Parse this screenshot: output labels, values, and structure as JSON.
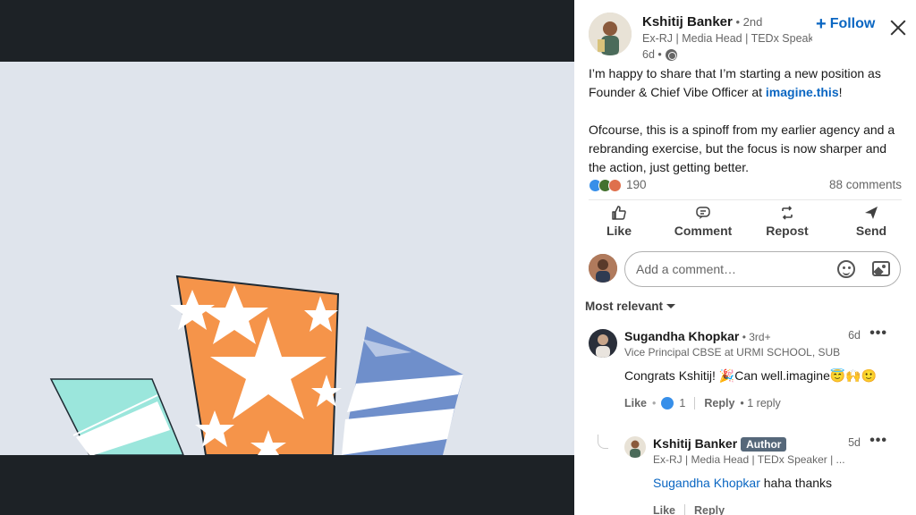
{
  "post": {
    "author_name": "Kshitij Banker",
    "author_degree": " • 2nd",
    "author_headline": "Ex-RJ | Media Head | TEDx Speak...",
    "time": "6d •",
    "follow_plus": "+",
    "follow_label": "Follow",
    "text_line1_prefix": "I’m happy to share that I’m starting a new position as Founder & Chief Vibe Officer at ",
    "text_link": "imagine.this",
    "text_line1_suffix": "!",
    "text_para2": "Ofcourse, this is a spinoff from my earlier agency and a rebranding exercise, but the focus is now sharper and the action, just getting better.",
    "reaction_count": "190",
    "comment_count": "88 comments"
  },
  "actions": [
    {
      "label": "Like",
      "icon": "like-icon"
    },
    {
      "label": "Comment",
      "icon": "comment-icon"
    },
    {
      "label": "Repost",
      "icon": "repost-icon"
    },
    {
      "label": "Send",
      "icon": "send-icon"
    }
  ],
  "comment_box": {
    "placeholder": "Add a comment…"
  },
  "sort": {
    "label": "Most relevant"
  },
  "comments": [
    {
      "name": "Sugandha Khopkar",
      "degree": " • 3rd+",
      "headline": "Vice Principal CBSE at URMI SCHOOL, SUB E...",
      "time": "6d",
      "more": "•••",
      "text": "Congrats Kshitij! 🎉Can well.imagine😇🙌🙂",
      "like_label": "Like",
      "like_count": "1",
      "reply_label": "Reply",
      "replies": "• 1 reply"
    },
    {
      "name": "Kshitij Banker",
      "badge": "Author",
      "headline": "Ex-RJ | Media Head | TEDx Speaker | ...",
      "time": "5d",
      "more": "•••",
      "mention": "Sugandha Khopkar",
      "text": " haha thanks",
      "like_label": "Like",
      "reply_label": "Reply"
    }
  ],
  "colors": {
    "link": "#0a66c2",
    "media_bg": "#dfe4ec",
    "orange": "#f5944a",
    "teal": "#9be6dc",
    "blue": "#6f8fcb"
  }
}
